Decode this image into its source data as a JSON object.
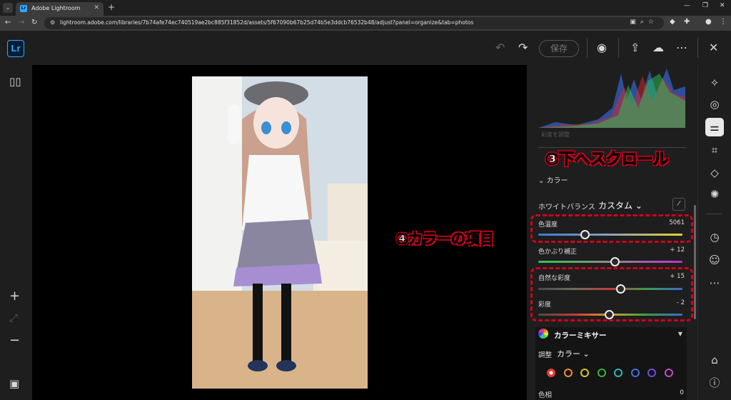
{
  "browser": {
    "tab_title": "Adobe Lightroom",
    "favicon_text": "Lr",
    "url": "lightroom.adobe.com/libraries/7b74afe74ec740519ae2bc885f31852d/assets/5f67090b67b25d74b5e3ddcb76532b48/adjust?panel=organize&tab=photos"
  },
  "header": {
    "logo": "Lr",
    "save_label": "保存"
  },
  "panel": {
    "histogram_caption": "彩度を調整",
    "section_title": "カラー",
    "white_balance_label": "ホワイトバランス",
    "white_balance_value": "カスタム",
    "sliders": [
      {
        "label": "色温度",
        "value": "5061",
        "position": 0.32
      },
      {
        "label": "色かぶり補正",
        "value": "+ 12",
        "position": 0.53
      },
      {
        "label": "自然な彩度",
        "value": "+ 15",
        "position": 0.57
      },
      {
        "label": "彩度",
        "value": "- 2",
        "position": 0.49
      }
    ],
    "mixer": {
      "title": "カラーミキサー",
      "adjust_label": "調整",
      "adjust_value": "カラー",
      "swatch_colors": [
        "#e53935",
        "#f08c2e",
        "#d8c52a",
        "#3cb043",
        "#2fb5b5",
        "#3f6fe0",
        "#6a4de0",
        "#c04fc8"
      ],
      "hue_label": "色相",
      "hue_value": "0"
    }
  },
  "annotations": {
    "scroll": "③下へスクロール",
    "color_items": "④カラーの項目",
    "color": "#d0021b"
  },
  "icons": {
    "browser": [
      "menu-icon",
      "close-icon",
      "plus-icon",
      "back-icon",
      "forward-icon",
      "reload-icon"
    ],
    "header": [
      "undo-icon",
      "redo-icon",
      "eye-icon",
      "share-icon",
      "cloud-icon",
      "more-icon",
      "close-icon"
    ],
    "left": [
      "compare-icon",
      "zoom-in-icon",
      "fit-icon",
      "zoom-out-icon",
      "filmstrip-icon"
    ],
    "right": [
      "auto-edit-icon",
      "healing-icon",
      "adjust-sliders-icon",
      "crop-icon",
      "eraser-icon",
      "radial-icon",
      "history-icon",
      "presets-icon",
      "more-icon",
      "tag-icon",
      "info-icon"
    ]
  }
}
